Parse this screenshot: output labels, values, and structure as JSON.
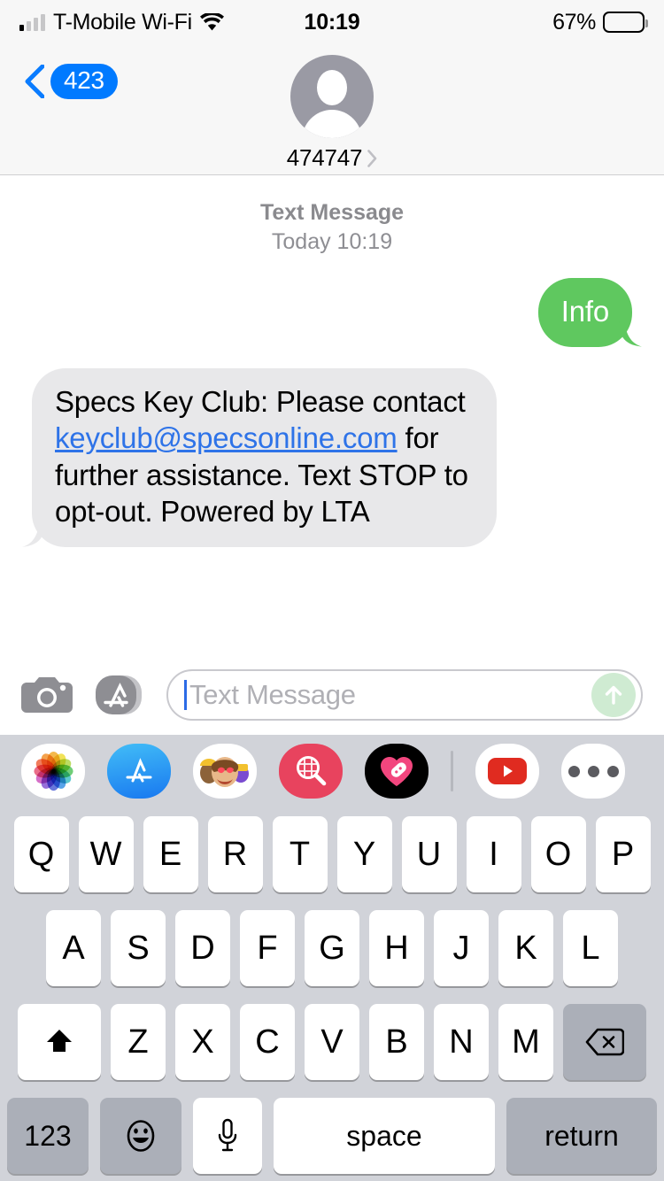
{
  "status_bar": {
    "carrier": "T-Mobile Wi-Fi",
    "signal_bars_filled": 1,
    "signal_bars_total": 4,
    "wifi_icon": "wifi-icon",
    "time": "10:19",
    "battery_percent": "67%",
    "battery_level": 67
  },
  "nav": {
    "back_label": "423",
    "back_icon": "chevron-left-icon",
    "avatar_icon": "person-avatar-icon",
    "contact_name": "474747",
    "detail_icon": "chevron-right-icon"
  },
  "thread": {
    "timestamp_kind": "Text Message",
    "timestamp_when": "Today 10:19",
    "messages": [
      {
        "direction": "outgoing",
        "text": "Info",
        "bubble_color": "#5FC85F"
      },
      {
        "direction": "incoming",
        "bubble_color": "#E8E8EA",
        "text_before": "Specs Key Club: Please contact ",
        "link_text": "keyclub@specsonline.com",
        "link_color": "#2E73E8",
        "text_after": " for further assistance. Text STOP to opt-out. Powered by LTA"
      }
    ]
  },
  "toolbar": {
    "camera_icon": "camera-icon",
    "appstore_icon": "app-store-icon",
    "placeholder": "Text Message",
    "input_value": "",
    "send_icon": "send-arrow-up-icon",
    "send_enabled": false
  },
  "app_drawer": {
    "apps": [
      {
        "name": "photos-app",
        "label": "Photos"
      },
      {
        "name": "app-store-app",
        "label": "App Store"
      },
      {
        "name": "memoji-stickers-app",
        "label": "Memoji Stickers"
      },
      {
        "name": "images-search-app",
        "label": "#images"
      },
      {
        "name": "health-app",
        "label": "Health"
      },
      {
        "name": "youtube-app",
        "label": "YouTube"
      },
      {
        "name": "more-apps",
        "label": "More"
      }
    ]
  },
  "keyboard": {
    "row1": [
      "Q",
      "W",
      "E",
      "R",
      "T",
      "Y",
      "U",
      "I",
      "O",
      "P"
    ],
    "row2": [
      "A",
      "S",
      "D",
      "F",
      "G",
      "H",
      "J",
      "K",
      "L"
    ],
    "row3": [
      "Z",
      "X",
      "C",
      "V",
      "B",
      "N",
      "M"
    ],
    "shift_icon": "shift-arrow-up-icon",
    "delete_icon": "delete-backspace-icon",
    "numbers_key": "123",
    "emoji_icon": "emoji-smiley-icon",
    "dictation_icon": "microphone-icon",
    "space_key": "space",
    "return_key": "return"
  }
}
